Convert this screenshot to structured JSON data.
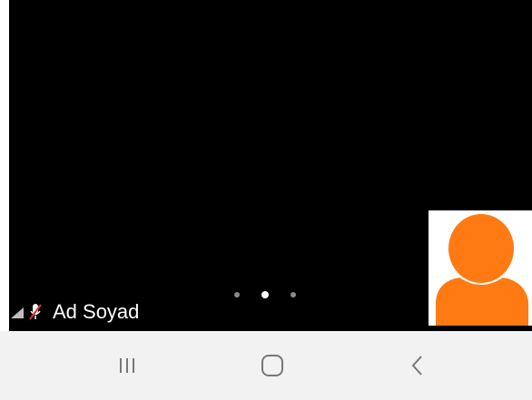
{
  "participant": {
    "name": "Ad Soyad",
    "mic_muted": true,
    "signal_icon": "signal-strength-icon",
    "mic_icon": "mic-muted-icon"
  },
  "pagination": {
    "total": 3,
    "active_index": 1
  },
  "self_view": {
    "avatar_icon": "person-avatar-icon",
    "avatar_color": "#ff7a12"
  },
  "nav_bar": {
    "recent_icon": "recent-apps-icon",
    "home_icon": "home-icon",
    "back_icon": "back-icon"
  }
}
